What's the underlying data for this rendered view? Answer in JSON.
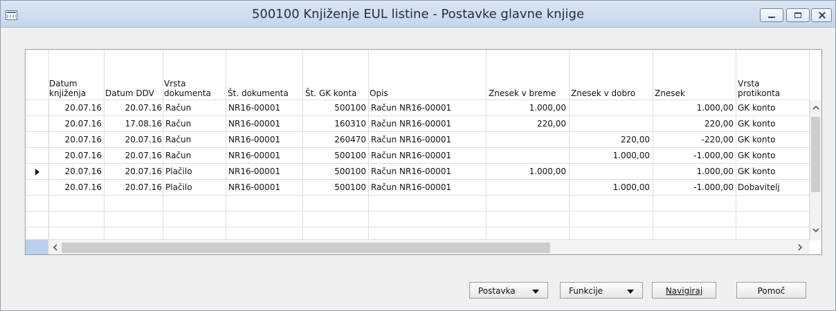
{
  "window": {
    "title": "500100 Knjiženje EUL listine - Postavke glavne knjige"
  },
  "table": {
    "headers": [
      "Datum\nknjiženja",
      "Datum DDV",
      "Vrsta\ndokumenta",
      "Št. dokumenta",
      "Št. GK konta",
      "Opis",
      "Znesek v breme",
      "Znesek v dobro",
      "Znesek",
      "Vrsta\nprotikonta"
    ],
    "rows": [
      {
        "datum": "20.07.16",
        "datum_ddv": "20.07.16",
        "vrsta": "Račun",
        "dokument": "NR16-00001",
        "konto": "500100",
        "opis": "Račun NR16-00001",
        "breme": "1.000,00",
        "dobro": "",
        "znesek": "1.000,00",
        "protikonto": "GK konto"
      },
      {
        "datum": "20.07.16",
        "datum_ddv": "17.08.16",
        "vrsta": "Račun",
        "dokument": "NR16-00001",
        "konto": "160310",
        "opis": "Račun NR16-00001",
        "breme": "220,00",
        "dobro": "",
        "znesek": "220,00",
        "protikonto": "GK konto"
      },
      {
        "datum": "20.07.16",
        "datum_ddv": "20.07.16",
        "vrsta": "Račun",
        "dokument": "NR16-00001",
        "konto": "260470",
        "opis": "Račun NR16-00001",
        "breme": "",
        "dobro": "220,00",
        "znesek": "-220,00",
        "protikonto": "GK konto"
      },
      {
        "datum": "20.07.16",
        "datum_ddv": "20.07.16",
        "vrsta": "Račun",
        "dokument": "NR16-00001",
        "konto": "500100",
        "opis": "Račun NR16-00001",
        "breme": "",
        "dobro": "1.000,00",
        "znesek": "-1.000,00",
        "protikonto": "GK konto"
      },
      {
        "datum": "20.07.16",
        "datum_ddv": "20.07.16",
        "vrsta": "Plačilo",
        "dokument": "NR16-00001",
        "konto": "500100",
        "opis": "Račun NR16-00001",
        "breme": "1.000,00",
        "dobro": "",
        "znesek": "1.000,00",
        "protikonto": "GK konto"
      },
      {
        "datum": "20.07.16",
        "datum_ddv": "20.07.16",
        "vrsta": "Plačilo",
        "dokument": "NR16-00001",
        "konto": "500100",
        "opis": "Račun NR16-00001",
        "breme": "",
        "dobro": "1.000,00",
        "znesek": "-1.000,00",
        "protikonto": "Dobavitelj"
      }
    ],
    "selected_row": 4
  },
  "buttons": {
    "postavka": "Postavka",
    "funkcije": "Funkcije",
    "navigiraj": "Navigiraj",
    "pomoc": "Pomoč"
  },
  "icons": [
    "app-icon",
    "minimize-icon",
    "maximize-icon",
    "close-icon",
    "row-pointer-icon",
    "scroll-left-icon",
    "scroll-right-icon",
    "scroll-up-icon",
    "scroll-down-icon",
    "dropdown-arrow-icon"
  ]
}
